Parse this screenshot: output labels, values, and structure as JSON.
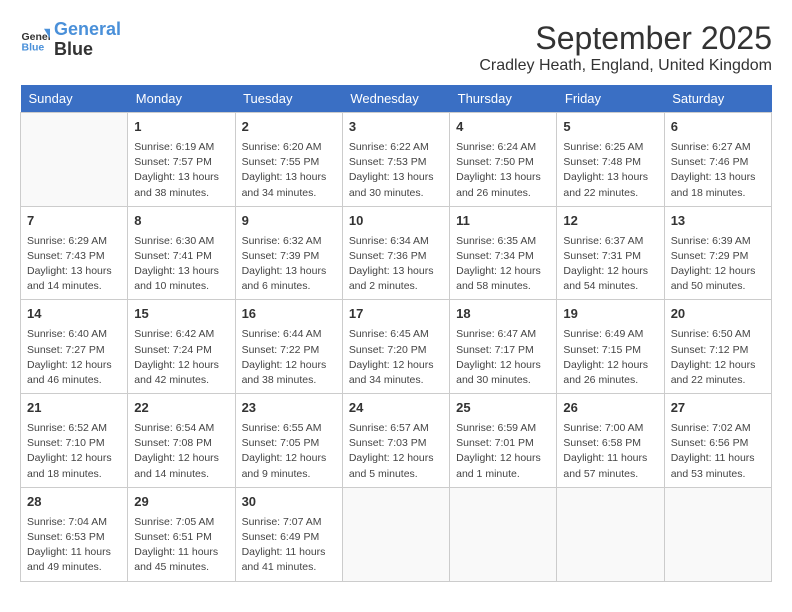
{
  "header": {
    "logo_line1": "General",
    "logo_line2": "Blue",
    "month": "September 2025",
    "location": "Cradley Heath, England, United Kingdom"
  },
  "weekdays": [
    "Sunday",
    "Monday",
    "Tuesday",
    "Wednesday",
    "Thursday",
    "Friday",
    "Saturday"
  ],
  "weeks": [
    [
      {
        "day": "",
        "info": ""
      },
      {
        "day": "1",
        "info": "Sunrise: 6:19 AM\nSunset: 7:57 PM\nDaylight: 13 hours\nand 38 minutes."
      },
      {
        "day": "2",
        "info": "Sunrise: 6:20 AM\nSunset: 7:55 PM\nDaylight: 13 hours\nand 34 minutes."
      },
      {
        "day": "3",
        "info": "Sunrise: 6:22 AM\nSunset: 7:53 PM\nDaylight: 13 hours\nand 30 minutes."
      },
      {
        "day": "4",
        "info": "Sunrise: 6:24 AM\nSunset: 7:50 PM\nDaylight: 13 hours\nand 26 minutes."
      },
      {
        "day": "5",
        "info": "Sunrise: 6:25 AM\nSunset: 7:48 PM\nDaylight: 13 hours\nand 22 minutes."
      },
      {
        "day": "6",
        "info": "Sunrise: 6:27 AM\nSunset: 7:46 PM\nDaylight: 13 hours\nand 18 minutes."
      }
    ],
    [
      {
        "day": "7",
        "info": "Sunrise: 6:29 AM\nSunset: 7:43 PM\nDaylight: 13 hours\nand 14 minutes."
      },
      {
        "day": "8",
        "info": "Sunrise: 6:30 AM\nSunset: 7:41 PM\nDaylight: 13 hours\nand 10 minutes."
      },
      {
        "day": "9",
        "info": "Sunrise: 6:32 AM\nSunset: 7:39 PM\nDaylight: 13 hours\nand 6 minutes."
      },
      {
        "day": "10",
        "info": "Sunrise: 6:34 AM\nSunset: 7:36 PM\nDaylight: 13 hours\nand 2 minutes."
      },
      {
        "day": "11",
        "info": "Sunrise: 6:35 AM\nSunset: 7:34 PM\nDaylight: 12 hours\nand 58 minutes."
      },
      {
        "day": "12",
        "info": "Sunrise: 6:37 AM\nSunset: 7:31 PM\nDaylight: 12 hours\nand 54 minutes."
      },
      {
        "day": "13",
        "info": "Sunrise: 6:39 AM\nSunset: 7:29 PM\nDaylight: 12 hours\nand 50 minutes."
      }
    ],
    [
      {
        "day": "14",
        "info": "Sunrise: 6:40 AM\nSunset: 7:27 PM\nDaylight: 12 hours\nand 46 minutes."
      },
      {
        "day": "15",
        "info": "Sunrise: 6:42 AM\nSunset: 7:24 PM\nDaylight: 12 hours\nand 42 minutes."
      },
      {
        "day": "16",
        "info": "Sunrise: 6:44 AM\nSunset: 7:22 PM\nDaylight: 12 hours\nand 38 minutes."
      },
      {
        "day": "17",
        "info": "Sunrise: 6:45 AM\nSunset: 7:20 PM\nDaylight: 12 hours\nand 34 minutes."
      },
      {
        "day": "18",
        "info": "Sunrise: 6:47 AM\nSunset: 7:17 PM\nDaylight: 12 hours\nand 30 minutes."
      },
      {
        "day": "19",
        "info": "Sunrise: 6:49 AM\nSunset: 7:15 PM\nDaylight: 12 hours\nand 26 minutes."
      },
      {
        "day": "20",
        "info": "Sunrise: 6:50 AM\nSunset: 7:12 PM\nDaylight: 12 hours\nand 22 minutes."
      }
    ],
    [
      {
        "day": "21",
        "info": "Sunrise: 6:52 AM\nSunset: 7:10 PM\nDaylight: 12 hours\nand 18 minutes."
      },
      {
        "day": "22",
        "info": "Sunrise: 6:54 AM\nSunset: 7:08 PM\nDaylight: 12 hours\nand 14 minutes."
      },
      {
        "day": "23",
        "info": "Sunrise: 6:55 AM\nSunset: 7:05 PM\nDaylight: 12 hours\nand 9 minutes."
      },
      {
        "day": "24",
        "info": "Sunrise: 6:57 AM\nSunset: 7:03 PM\nDaylight: 12 hours\nand 5 minutes."
      },
      {
        "day": "25",
        "info": "Sunrise: 6:59 AM\nSunset: 7:01 PM\nDaylight: 12 hours\nand 1 minute."
      },
      {
        "day": "26",
        "info": "Sunrise: 7:00 AM\nSunset: 6:58 PM\nDaylight: 11 hours\nand 57 minutes."
      },
      {
        "day": "27",
        "info": "Sunrise: 7:02 AM\nSunset: 6:56 PM\nDaylight: 11 hours\nand 53 minutes."
      }
    ],
    [
      {
        "day": "28",
        "info": "Sunrise: 7:04 AM\nSunset: 6:53 PM\nDaylight: 11 hours\nand 49 minutes."
      },
      {
        "day": "29",
        "info": "Sunrise: 7:05 AM\nSunset: 6:51 PM\nDaylight: 11 hours\nand 45 minutes."
      },
      {
        "day": "30",
        "info": "Sunrise: 7:07 AM\nSunset: 6:49 PM\nDaylight: 11 hours\nand 41 minutes."
      },
      {
        "day": "",
        "info": ""
      },
      {
        "day": "",
        "info": ""
      },
      {
        "day": "",
        "info": ""
      },
      {
        "day": "",
        "info": ""
      }
    ]
  ]
}
